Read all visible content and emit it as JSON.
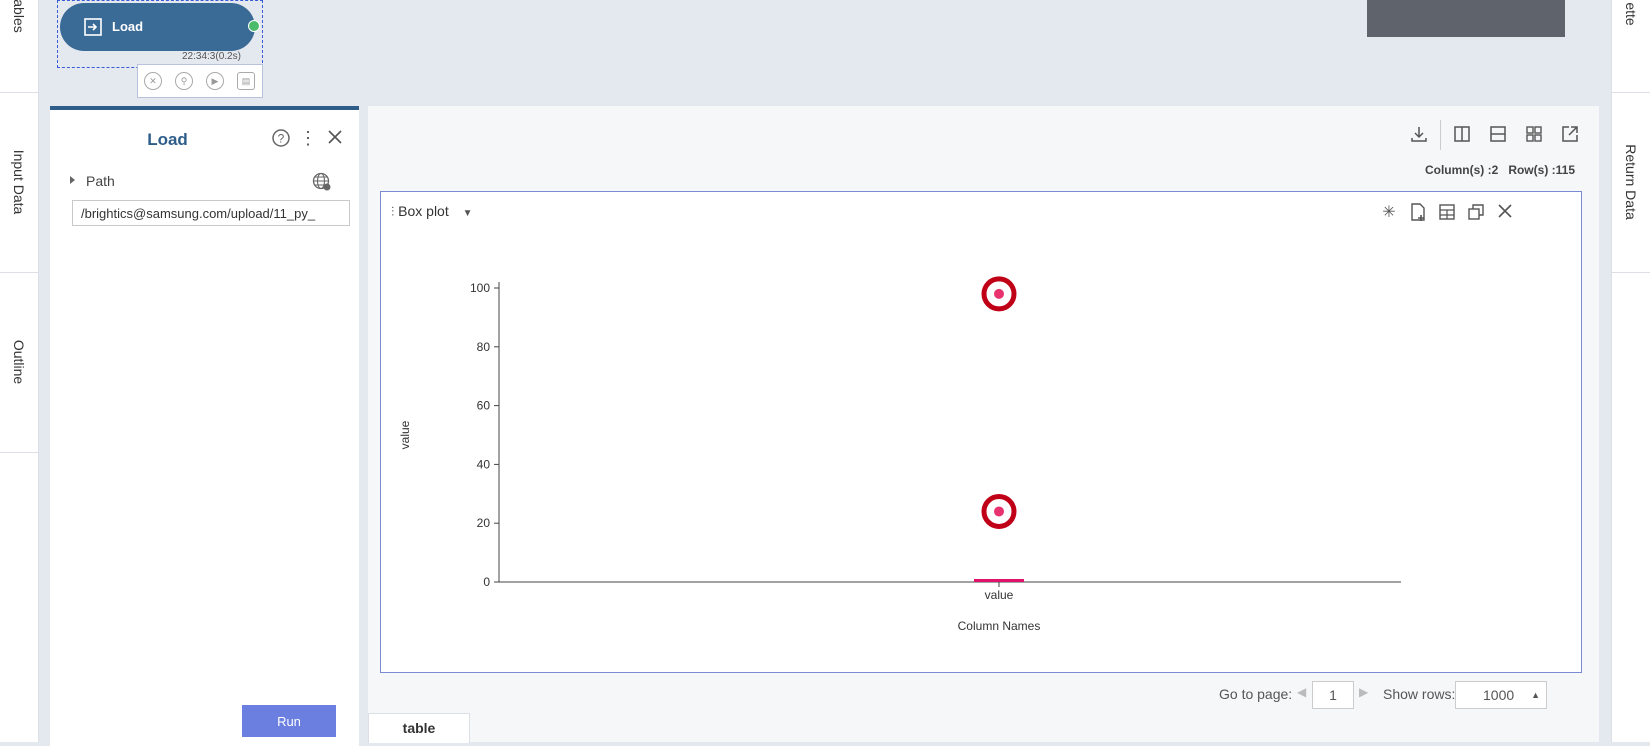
{
  "left_sidebar": {
    "tabs": [
      "ables",
      "Input Data",
      "Outline"
    ]
  },
  "right_sidebar": {
    "tabs": [
      "ette",
      "Return Data"
    ]
  },
  "workflow": {
    "node": {
      "label": "Load",
      "time": "22:34:3(0.2s)"
    }
  },
  "property_panel": {
    "title": "Load",
    "path_label": "Path",
    "path_value": "/brightics@samsung.com/upload/11_py_",
    "run_label": "Run"
  },
  "result_panel": {
    "columns_label": "Column(s) :2",
    "rows_label": "Row(s) :115",
    "chart_type_label": "Box plot",
    "pager": {
      "go_to_label": "Go to page:",
      "page": "1",
      "show_rows_label": "Show rows:",
      "rows_value": "1000"
    },
    "tab": "table"
  },
  "colors": {
    "node": "#3a6a96",
    "accent": "#2e5d8a",
    "run_button": "#6b7fe0",
    "outlier_ring": "#c00016",
    "outlier_dot": "#e8336f",
    "box": "#e0126a"
  },
  "chart_data": {
    "type": "box",
    "categories": [
      "value"
    ],
    "xlabel": "Column Names",
    "ylabel": "value",
    "ylim": [
      0,
      100
    ],
    "yticks": [
      0,
      20,
      40,
      60,
      80,
      100
    ],
    "box": {
      "min": 0,
      "q1": 0,
      "median": 0,
      "q3": 1,
      "max": 1
    },
    "outliers": [
      24,
      98
    ],
    "grid": false
  }
}
